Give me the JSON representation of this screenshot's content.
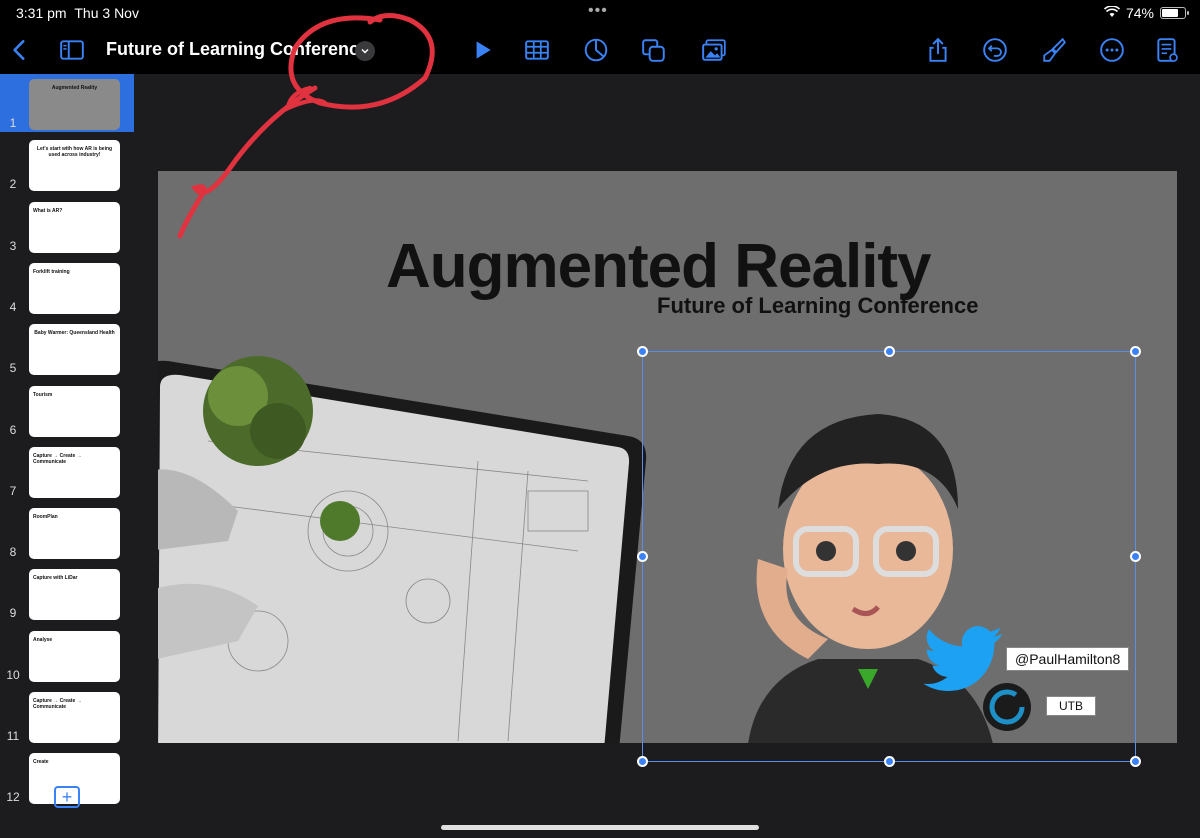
{
  "status_bar": {
    "time": "3:31 pm",
    "date": "Thu 3 Nov",
    "battery": "74%",
    "battery_level": 0.74
  },
  "toolbar": {
    "document_title": "Future of Learning Conference",
    "accent_color": "#3b82f6",
    "buttons": [
      "back-icon",
      "sidebar-icon",
      "play-icon",
      "table-icon",
      "chart-icon",
      "shapes-icon",
      "media-icon",
      "share-icon",
      "undo-icon",
      "format-brush-icon",
      "more-icon",
      "presenter-notes-icon"
    ]
  },
  "sidebar": {
    "slides": [
      {
        "number": "1",
        "text": "Augmented Reality",
        "selected": true
      },
      {
        "number": "2",
        "text": "Let's start with how AR is being used across industry!"
      },
      {
        "number": "3",
        "text": "What is AR?"
      },
      {
        "number": "4",
        "text": "Forklift training"
      },
      {
        "number": "5",
        "text": "Baby Warmer: Queensland Health"
      },
      {
        "number": "6",
        "text": "Tourism"
      },
      {
        "number": "7",
        "text": "Capture → Create → Communicate"
      },
      {
        "number": "8",
        "text": "RoomPlan"
      },
      {
        "number": "9",
        "text": "Capture with LiDar"
      },
      {
        "number": "10",
        "text": "Analyse"
      },
      {
        "number": "11",
        "text": "Capture → Create → Communicate"
      },
      {
        "number": "12",
        "text": "Create"
      }
    ],
    "add_slide_label": "+"
  },
  "slide": {
    "title": "Augmented Reality",
    "subtitle": "Future of Learning Conference",
    "twitter_handle": "@PaulHamilton8",
    "org_label": "UTB"
  }
}
